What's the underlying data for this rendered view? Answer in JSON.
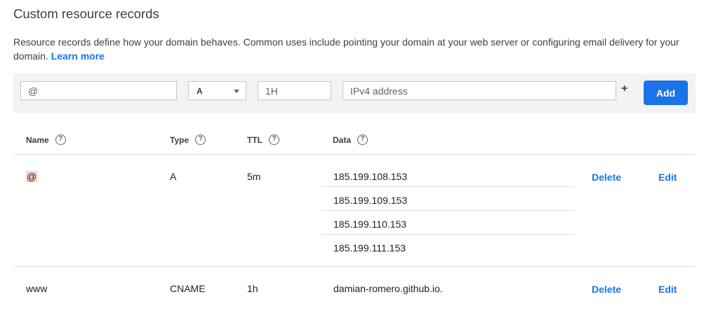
{
  "section": {
    "title": "Custom resource records",
    "description": "Resource records define how your domain behaves. Common uses include pointing your domain at your web server or configuring email delivery for your domain.",
    "learn_more": "Learn more"
  },
  "toolbar": {
    "name_value": "@",
    "type_value": "A",
    "ttl_value": "1H",
    "data_placeholder": "IPv4 address",
    "plus_label": "+",
    "add_label": "Add"
  },
  "table": {
    "headers": {
      "name": "Name",
      "type": "Type",
      "ttl": "TTL",
      "data": "Data",
      "help_glyph": "?"
    },
    "rows": [
      {
        "name": "@",
        "type": "A",
        "ttl": "5m",
        "data": [
          "185.199.108.153",
          "185.199.109.153",
          "185.199.110.153",
          "185.199.111.153"
        ],
        "delete_label": "Delete",
        "edit_label": "Edit"
      },
      {
        "name": "www",
        "type": "CNAME",
        "ttl": "1h",
        "data": [
          "damian-romero.github.io."
        ],
        "delete_label": "Delete",
        "edit_label": "Edit"
      }
    ]
  },
  "colors": {
    "accent": "#1a73e8",
    "toolbar_bg": "#f1f3f4",
    "highlight": "#f8d8c4"
  }
}
